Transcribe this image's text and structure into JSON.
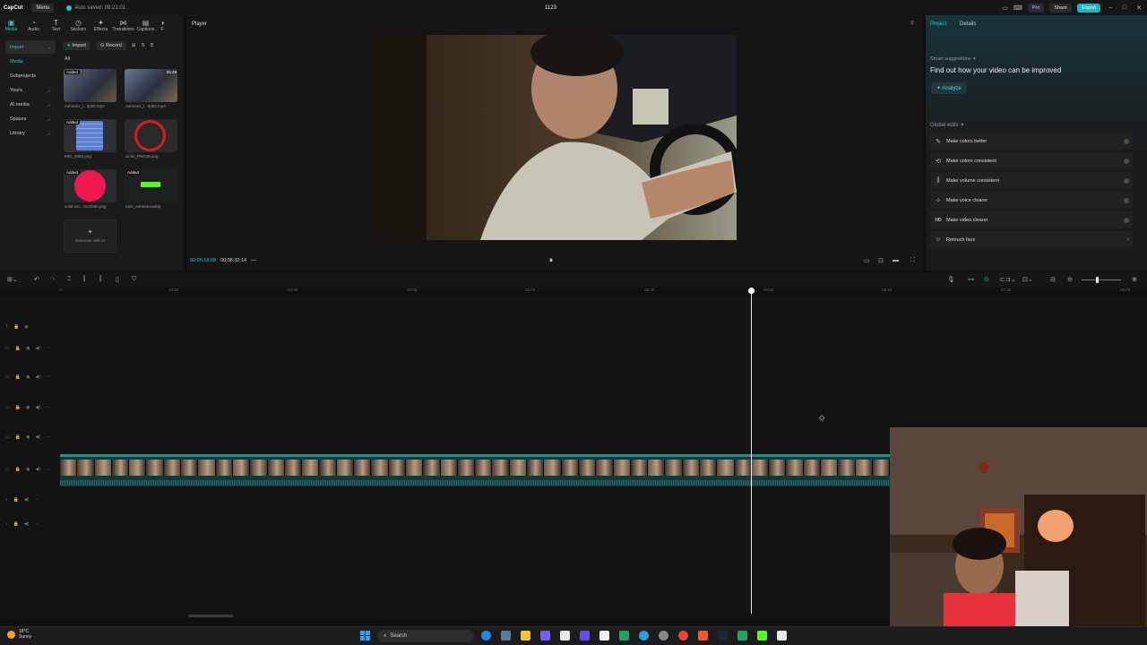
{
  "titlebar": {
    "logo": "CapCut",
    "menu": "Menu",
    "autosave": "Auto saved: 09:21:01",
    "project": "1123",
    "pro": "Pro",
    "share": "Share",
    "export": "Export"
  },
  "tools": [
    {
      "label": "Media",
      "icon": "media-icon"
    },
    {
      "label": "Audio",
      "icon": "audio-icon"
    },
    {
      "label": "Text",
      "icon": "text-icon"
    },
    {
      "label": "Stickers",
      "icon": "stickers-icon"
    },
    {
      "label": "Effects",
      "icon": "effects-icon"
    },
    {
      "label": "Transitions",
      "icon": "transitions-icon"
    },
    {
      "label": "Captions",
      "icon": "captions-icon"
    },
    {
      "label": "F",
      "icon": "filters-icon"
    }
  ],
  "sidenav": {
    "import": "Import",
    "media": "Media",
    "subprojects": "Subprojects",
    "yours": "Yours",
    "ai_media": "AI media",
    "spaces": "Spaces",
    "library": "Library"
  },
  "media_header": {
    "import": "Import",
    "record": "Record"
  },
  "all_label": "All",
  "media_items": [
    {
      "tag": "Added",
      "duration": "",
      "label": "Ashneez_l...0pb0.mp4"
    },
    {
      "tag": "",
      "duration": "05:49",
      "label": "Ashneez_l...0pb0.mp4"
    },
    {
      "tag": "Added",
      "duration": "",
      "label": "IMG_2958.png"
    },
    {
      "tag": "",
      "duration": "",
      "label": "circle_PNG49.png"
    },
    {
      "tag": "Added",
      "duration": "",
      "label": "solid-circ...humb5b.png"
    },
    {
      "tag": "Added",
      "duration": "",
      "label": "Kick_Ashneezwebp"
    }
  ],
  "generate_ai": "Generate with AI",
  "player": {
    "title": "Player",
    "current_time": "00:05:18:09",
    "total_time": "00:36:32:14"
  },
  "right_panel": {
    "tab_project": "Project",
    "tab_details": "Details",
    "smart_suggestions": "Smart suggestions",
    "smart_heading": "Find out how your video can be improved",
    "analyze": "Analyze",
    "global_edits": "Global edits",
    "items": [
      {
        "label": "Make colors better",
        "icon": "palette-icon"
      },
      {
        "label": "Make colors consistent",
        "icon": "color-match-icon"
      },
      {
        "label": "Make volume consistent",
        "icon": "volume-levels-icon"
      },
      {
        "label": "Make voice clearer",
        "icon": "voice-icon"
      },
      {
        "label": "Make video clearer",
        "icon": "hd-icon"
      },
      {
        "label": "Retouch face",
        "icon": "retouch-icon"
      }
    ]
  },
  "ruler_ticks": [
    "0f",
    "03:00",
    "04:40",
    "04:00",
    "05:00",
    "05:30",
    "06:00",
    "06:40",
    "07:40",
    "09:00"
  ],
  "taskbar": {
    "temperature": "18°C",
    "condition": "Sunny",
    "search": "Search"
  }
}
